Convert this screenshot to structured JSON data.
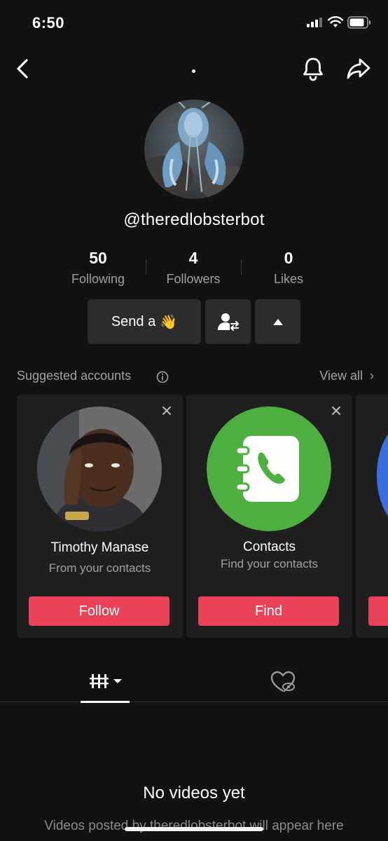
{
  "status_bar": {
    "time": "6:50"
  },
  "profile": {
    "username": "@theredlobsterbot",
    "stats": [
      {
        "value": "50",
        "label": "Following"
      },
      {
        "value": "4",
        "label": "Followers"
      },
      {
        "value": "0",
        "label": "Likes"
      }
    ],
    "send_button_label": "Send a",
    "send_button_emoji": "👋"
  },
  "suggested": {
    "title": "Suggested accounts",
    "view_all": "View all",
    "cards": [
      {
        "name": "Timothy Manase",
        "subtitle": "From your contacts",
        "button": "Follow"
      },
      {
        "name": "Contacts",
        "subtitle": "Find your contacts",
        "button": "Find"
      }
    ]
  },
  "empty_state": {
    "title": "No videos yet",
    "subtitle": "Videos posted by theredlobsterbot will appear here"
  },
  "icons": {
    "back": "chevron-left-icon",
    "bell": "bell-icon",
    "share": "share-icon",
    "swap_user": "user-swap-icon",
    "caret": "caret-up-icon",
    "info": "info-icon",
    "close": "close-icon",
    "grid": "grid-icon",
    "liked_hidden": "heart-hidden-icon"
  },
  "colors": {
    "accent": "#ea4359",
    "contacts_green": "#4caf3f",
    "background": "#121212",
    "card": "#1f1f1f"
  }
}
